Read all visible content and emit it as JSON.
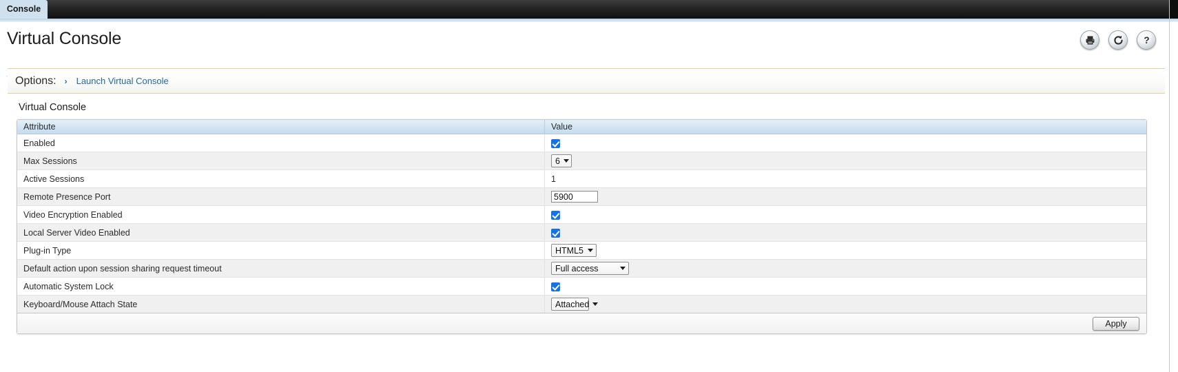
{
  "tabbar": {
    "active_tab": "Console"
  },
  "header": {
    "title": "Virtual Console",
    "icons": [
      {
        "name": "print-icon",
        "label": "Print"
      },
      {
        "name": "refresh-icon",
        "label": "Refresh"
      },
      {
        "name": "help-icon",
        "label": "Help"
      }
    ]
  },
  "options": {
    "label": "Options:",
    "arrow": "›",
    "link": "Launch Virtual Console"
  },
  "main": {
    "section_title": "Virtual Console",
    "columns": {
      "attribute": "Attribute",
      "value": "Value"
    },
    "rows": [
      {
        "attribute": "Enabled",
        "type": "checkbox",
        "checked": true,
        "value": ""
      },
      {
        "attribute": "Max Sessions",
        "type": "select",
        "value": "6",
        "width": "w-xs"
      },
      {
        "attribute": "Active Sessions",
        "type": "text",
        "value": "1"
      },
      {
        "attribute": "Remote Presence Port",
        "type": "input",
        "value": "5900"
      },
      {
        "attribute": "Video Encryption Enabled",
        "type": "checkbox",
        "checked": true,
        "value": ""
      },
      {
        "attribute": "Local Server Video Enabled",
        "type": "checkbox",
        "checked": true,
        "value": ""
      },
      {
        "attribute": "Plug-in Type",
        "type": "select",
        "value": "HTML5",
        "width": "w-md"
      },
      {
        "attribute": "Default action upon session sharing request timeout",
        "type": "select",
        "value": "Full access",
        "width": "w-lg"
      },
      {
        "attribute": "Automatic System Lock",
        "type": "checkbox",
        "checked": true,
        "value": ""
      },
      {
        "attribute": "Keyboard/Mouse Attach State",
        "type": "select",
        "value": "Attached",
        "width": "w-sm"
      }
    ],
    "apply_label": "Apply"
  },
  "colors": {
    "tab_active_bg": "#cfe0ef",
    "tabbar_bg": "#0d0d0d",
    "options_border": "#e8cf9a",
    "link": "#2167a8",
    "checkbox": "#1473e6",
    "table_header": "#d4e6f4",
    "row_alt": "#f0f0f0"
  }
}
